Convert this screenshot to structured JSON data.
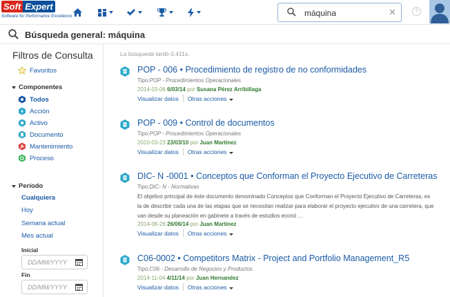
{
  "header": {
    "logo_soft": "Soft",
    "logo_expert": "Expert",
    "logo_tagline": "Software for Performance Excellence",
    "nav_items": [
      "home-icon",
      "dashboard-icon",
      "tasks-icon",
      "trophy-icon",
      "flash-icon"
    ],
    "search_value": "máquina",
    "help_glyph": "?"
  },
  "page": {
    "title": "Búsqueda general: máquina"
  },
  "sidebar": {
    "title": "Filtros de Consulta",
    "favorites_label": "Favoritos",
    "components_header": "Componentes",
    "components": [
      {
        "label": "Todos",
        "icon": "all-components-icon",
        "color": "#1a5aa6",
        "active": true
      },
      {
        "label": "Acción",
        "icon": "action-icon",
        "color": "#2aa8c9"
      },
      {
        "label": "Activo",
        "icon": "asset-icon",
        "color": "#2aa8c9"
      },
      {
        "label": "Documento",
        "icon": "document-icon",
        "color": "#2aa8c9"
      },
      {
        "label": "Mantenimiento",
        "icon": "maintenance-icon",
        "color": "#e14545"
      },
      {
        "label": "Proceso",
        "icon": "process-icon",
        "color": "#3bb55a"
      }
    ],
    "period_header": "Período",
    "periods": [
      {
        "label": "Cualquiera",
        "active": true
      },
      {
        "label": "Hoy"
      },
      {
        "label": "Semana actual"
      },
      {
        "label": "Mes actual"
      }
    ],
    "start_label": "Inicial",
    "end_label": "Fin",
    "date_placeholder": "DD/MM/YYYY"
  },
  "results": {
    "timing": "La búsqueda tardó 0.411s.",
    "items": [
      {
        "title": "POP - 006 • Procedimiento de registro de no conformidades",
        "type_prefix": "Tipo:",
        "type_value": "POP - Procedimientos Operacionales",
        "description": "",
        "created": "2014-03-06",
        "updated": "6/03/14",
        "by": "por",
        "author": "Susana Pérez Arribillaga",
        "action_view": "Visualizar datos",
        "action_more": "Otras acciones"
      },
      {
        "title": "POP - 009 • Control de documentos",
        "type_prefix": "Tipo:",
        "type_value": "POP - Procedimientos Operacionales",
        "description": "",
        "created": "2010-03-23",
        "updated": "23/03/10",
        "by": "por",
        "author": "Juan Martinez",
        "action_view": "Visualizar datos",
        "action_more": "Otras acciones"
      },
      {
        "title": "DIC- N -0001 • Conceptos que Conforman el Proyecto Ejecutivo de Carreteras",
        "type_prefix": "Tipo:",
        "type_value": "DIC- N - Normativas",
        "description": "El objetivo principal de éste documento denominado Conceptos que Conforman el Proyecto Ejecutivo de Carreteras, es la de describir cada una de las etapas que se necesitan realizar para elaborar el proyecto ejecutivo de una carretera, que van desde su planeación en gabinete a través de estudios econó ...",
        "created": "2014-06-26",
        "updated": "26/06/14",
        "by": "por",
        "author": "Juan Martinez",
        "action_view": "Visualizar datos",
        "action_more": "Otras acciones"
      },
      {
        "title": "C06-0002 • Competitors Matrix - Project and Portfolio Management_R5",
        "type_prefix": "Tipo:",
        "type_value": "C06 - Desarrollo de Negocios y Productos",
        "description": "",
        "created": "2014-11-04",
        "updated": "4/11/14",
        "by": "por",
        "author": "Juan Hernandez",
        "action_view": "Visualizar datos",
        "action_more": "Otras acciones"
      }
    ]
  }
}
